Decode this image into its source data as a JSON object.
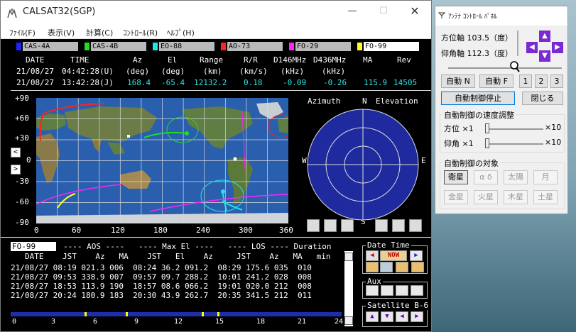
{
  "window": {
    "title": "CALSAT32(SGP)"
  },
  "menu": [
    "ﾌｧｲﾙ(F)",
    "表示(V)",
    "計算(C)",
    "ｺﾝﾄﾛｰﾙ(R)",
    "ﾍﾙﾌﾟ(H)"
  ],
  "satellites": [
    {
      "name": "CAS-4A",
      "color": "#2222ff"
    },
    {
      "name": "CAS-4B",
      "color": "#22dd22"
    },
    {
      "name": "EO-88",
      "color": "#22e5e5"
    },
    {
      "name": "AO-73",
      "color": "#ff2222"
    },
    {
      "name": "FO-29",
      "color": "#ff22ff"
    },
    {
      "name": "FO-99",
      "color": "#ffff22"
    }
  ],
  "table_headers": {
    "row1": [
      "DATE",
      "TIME",
      "Az",
      "El",
      "Range",
      "R/R",
      "D146MHz",
      "D436MHz",
      "MA",
      "Rev"
    ],
    "row2": [
      "(deg)",
      "(deg)",
      "(km)",
      "(km/s)",
      "(kHz)",
      "(kHz)"
    ]
  },
  "time_rows": [
    {
      "date": "21/08/27",
      "time": "04:42:28(U)"
    },
    {
      "date": "21/08/27",
      "time": "13:42:28(J)",
      "az": "168.4",
      "el": "-65.4",
      "range": "12132.2",
      "rr": "0.18",
      "d146": "-0.09",
      "d436": "-0.26",
      "ma": "115.9",
      "rev": "14505"
    }
  ],
  "map": {
    "lat_labels": [
      "+90",
      "+60",
      "+30",
      "0",
      "-30",
      "-60",
      "-90"
    ],
    "lon_labels": [
      "0",
      "60",
      "120",
      "180",
      "240",
      "300",
      "360"
    ]
  },
  "polar": {
    "azimuth_label": "Azimuth",
    "elevation_label": "Elevation",
    "n": "N",
    "s": "S",
    "e": "E",
    "w": "W"
  },
  "pass": {
    "satellite": "FO-99",
    "header1": "---- AOS ----   ---- Max El ----   ---- LOS ---- Duration",
    "header2": "DATE    JST    Az   MA    JST   El    Az     JST    Az   MA   min",
    "rows": [
      "21/08/27 08:19 021.3 006  08:24 36.2 091.2  08:29 175.6 035  010",
      "21/08/27 09:53 338.9 007  09:57 09.7 288.2  10:01 241.2 028  008",
      "21/08/27 18:53 113.9 190  18:57 08.6 066.2  19:01 020.0 212  008",
      "21/08/27 20:24 180.9 183  20:30 43.9 262.7  20:35 341.5 212  011"
    ],
    "timeline_labels": [
      "0",
      "3",
      "6",
      "9",
      "12",
      "15",
      "18",
      "21",
      "24"
    ]
  },
  "datetime_box": {
    "title": "Date Time",
    "now_label": "NOW"
  },
  "aux_box": {
    "title": "Aux"
  },
  "satellite_box": {
    "title": "Satellite B-6"
  },
  "antenna": {
    "title": "ｱﾝﾃﾅ ｺﾝﾄﾛｰﾙ ﾊﾟﾈﾙ",
    "azimuth": "方位軸 103.5（度）",
    "elevation": "仰角軸 112.3（度）",
    "auto_n": "自動 N",
    "auto_f": "自動 F",
    "btn1": "1",
    "btn2": "2",
    "btn3": "3",
    "stop": "自動制御停止",
    "close": "閉じる",
    "speed_group": "自動制御の速度調整",
    "az_speed": "方位  ×1",
    "el_speed": "仰角  ×1",
    "x10": "×10",
    "target_group": "自動制御の対象",
    "targets": [
      "衛星",
      "α δ",
      "太陽",
      "月",
      "金星",
      "火星",
      "木星",
      "土星"
    ]
  }
}
